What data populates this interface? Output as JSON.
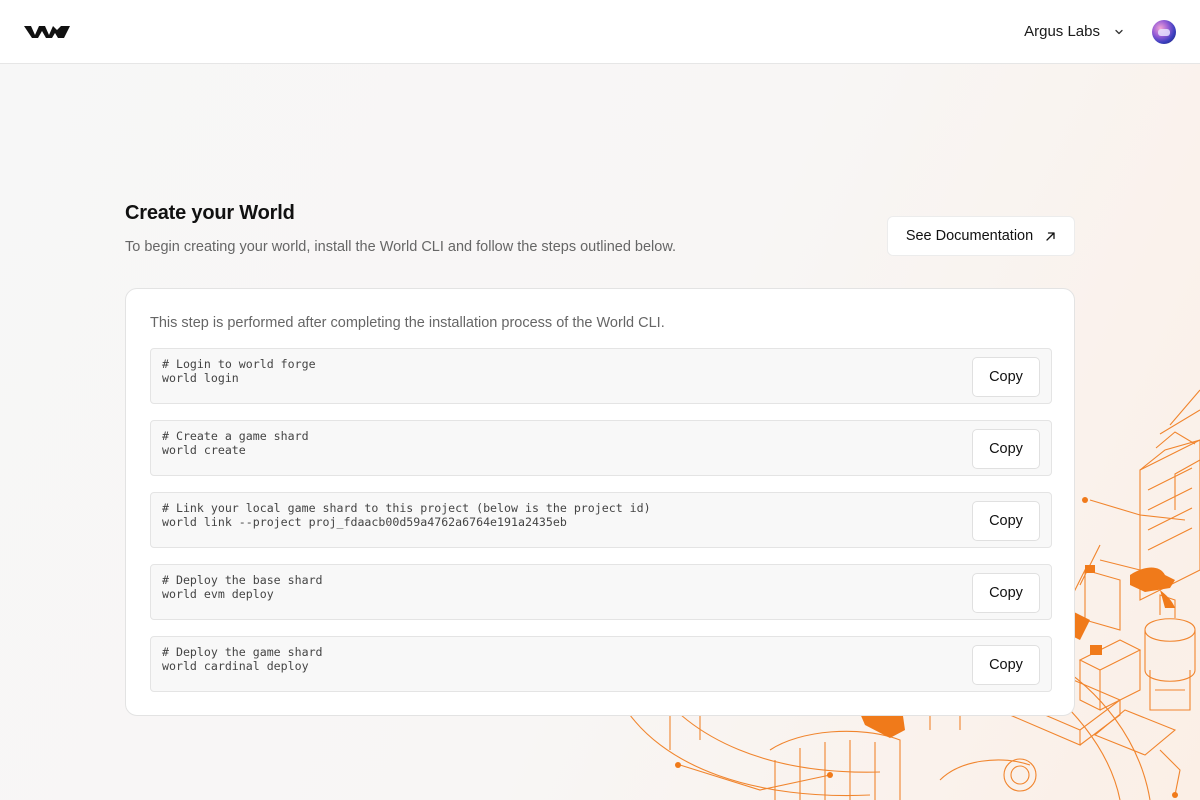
{
  "header": {
    "org_name": "Argus Labs"
  },
  "page": {
    "title": "Create your World",
    "subtitle": "To begin creating your world, install the World CLI and follow the steps outlined below.",
    "doc_button_label": "See Documentation"
  },
  "card": {
    "intro": "This step is performed after completing the installation process of the World CLI.",
    "copy_label": "Copy",
    "steps": [
      {
        "comment": "# Login to world forge",
        "command": "world login"
      },
      {
        "comment": "# Create a game shard",
        "command": "world create"
      },
      {
        "comment": "# Link your local game shard to this project (below is the project id)",
        "command": "world link --project proj_fdaacb00d59a4762a6764e191a2435eb"
      },
      {
        "comment": "# Deploy the base shard",
        "command": "world evm deploy"
      },
      {
        "comment": "# Deploy the game shard",
        "command": "world cardinal deploy"
      }
    ]
  },
  "colors": {
    "accent": "#f07a1a",
    "page_bg": "#f7f7f7"
  }
}
